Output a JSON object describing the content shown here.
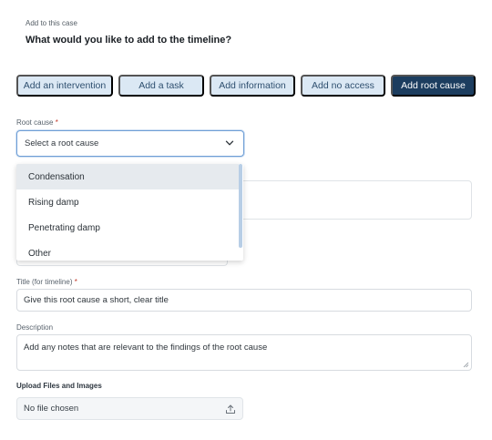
{
  "header": {
    "eyebrow": "Add to this case",
    "title": "What would you like to add to the timeline?"
  },
  "actions": {
    "intervention": "Add an intervention",
    "task": "Add a task",
    "information": "Add information",
    "no_access": "Add no access",
    "root_cause": "Add root cause",
    "selected": "Add root cause"
  },
  "root_cause": {
    "label": "Root cause",
    "required_mark": "*",
    "placeholder": "Select a root cause",
    "options": [
      "Condensation",
      "Rising damp",
      "Penetrating damp",
      "Other"
    ],
    "highlighted": "Condensation"
  },
  "title_field": {
    "label": "Title (for timeline)",
    "required_mark": "*",
    "placeholder": "Give this root cause a short, clear title"
  },
  "description": {
    "label": "Description",
    "placeholder": "Add any notes that are relevant to the findings of the root cause"
  },
  "upload": {
    "label": "Upload Files and Images",
    "value": "No file chosen"
  },
  "colors": {
    "accent": "#1c3d5f",
    "button_bg": "#dbe8f4",
    "button_text": "#2e4f6f",
    "focus_border": "#6f9ed6",
    "required": "#c0392b"
  },
  "icons": {
    "select_chevron": "chevron-down-icon",
    "upload": "upload-icon",
    "resize": "resize-handle-icon"
  }
}
